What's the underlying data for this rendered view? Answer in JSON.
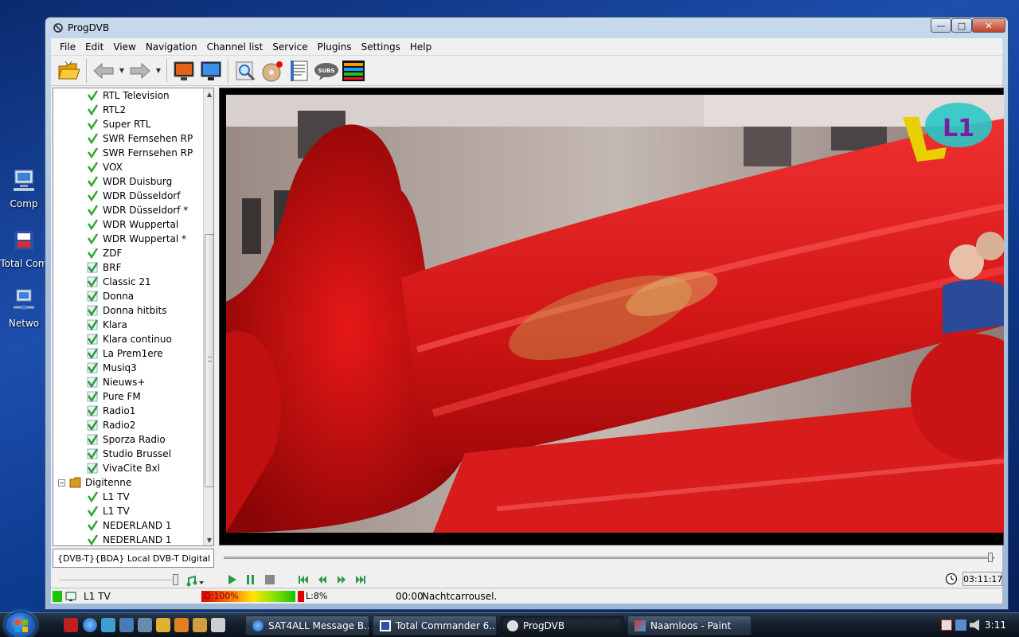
{
  "desktop": {
    "icons": [
      {
        "label": "Comp",
        "icon": "computer-icon"
      },
      {
        "label": "Total Com",
        "icon": "total-commander-icon"
      },
      {
        "label": "Netwo",
        "icon": "network-icon"
      }
    ]
  },
  "window": {
    "title": "ProgDVB",
    "buttons": {
      "minimize": "—",
      "maximize": "□",
      "close": "✕"
    }
  },
  "menu": [
    "File",
    "Edit",
    "View",
    "Navigation",
    "Channel list",
    "Service",
    "Plugins",
    "Settings",
    "Help"
  ],
  "toolbar": {
    "icons": [
      "open-folder-icon",
      "back-icon",
      "forward-icon",
      "tv-screen-icon",
      "monitor-icon",
      "scan-icon",
      "disc-record-icon",
      "epg-icon",
      "subs-icon",
      "equalizer-icon"
    ],
    "subs_label": "SUBS"
  },
  "channels": [
    {
      "name": "RTL Television",
      "type": "tv"
    },
    {
      "name": "RTL2",
      "type": "tv"
    },
    {
      "name": "Super RTL",
      "type": "tv"
    },
    {
      "name": "SWR Fernsehen RP",
      "type": "tv"
    },
    {
      "name": "SWR Fernsehen RP",
      "type": "tv"
    },
    {
      "name": "VOX",
      "type": "tv"
    },
    {
      "name": "WDR Duisburg",
      "type": "tv"
    },
    {
      "name": "WDR Düsseldorf",
      "type": "tv"
    },
    {
      "name": "WDR Düsseldorf *",
      "type": "tv"
    },
    {
      "name": "WDR Wuppertal",
      "type": "tv"
    },
    {
      "name": "WDR Wuppertal *",
      "type": "tv"
    },
    {
      "name": "ZDF",
      "type": "tv"
    },
    {
      "name": "BRF",
      "type": "radio"
    },
    {
      "name": "Classic 21",
      "type": "radio"
    },
    {
      "name": "Donna",
      "type": "radio"
    },
    {
      "name": "Donna hitbits",
      "type": "radio"
    },
    {
      "name": "Klara",
      "type": "radio"
    },
    {
      "name": "Klara continuo",
      "type": "radio"
    },
    {
      "name": "La Prem1ere",
      "type": "radio"
    },
    {
      "name": "Musiq3",
      "type": "radio"
    },
    {
      "name": "Nieuws+",
      "type": "radio"
    },
    {
      "name": "Pure FM",
      "type": "radio"
    },
    {
      "name": "Radio1",
      "type": "radio"
    },
    {
      "name": "Radio2",
      "type": "radio"
    },
    {
      "name": "Sporza Radio",
      "type": "radio"
    },
    {
      "name": "Studio Brussel",
      "type": "radio"
    },
    {
      "name": "VivaCite Bxl",
      "type": "radio"
    }
  ],
  "group": {
    "name": "Digitenne",
    "expander": "−"
  },
  "group_channels": [
    {
      "name": "L1 TV",
      "type": "tv"
    },
    {
      "name": "L1 TV",
      "type": "tv"
    },
    {
      "name": "NEDERLAND 1",
      "type": "tv"
    },
    {
      "name": "NEDERLAND 1",
      "type": "tv"
    }
  ],
  "source": "{DVB-T}{BDA} Local DVB-T Digital Antenna",
  "volume_level": 0.97,
  "playback": {
    "progress": 0.99,
    "time": "03:11:17",
    "buttons": [
      "play-icon",
      "pause-icon",
      "stop-icon",
      "skip-back-icon",
      "rewind-icon",
      "fast-forward-icon",
      "skip-forward-icon"
    ]
  },
  "video": {
    "logo_text": "L1"
  },
  "status": {
    "channel": "L1 TV",
    "quality": "Q:100%",
    "level": "L:8%",
    "epg_time": "00:00",
    "epg_title": "Nachtcarrousel."
  },
  "taskbar": {
    "tasks": [
      {
        "label": "SAT4ALL Message B...",
        "icon": "ie-icon",
        "active": false
      },
      {
        "label": "Total Commander 6...",
        "icon": "total-commander-icon",
        "active": false
      },
      {
        "label": "ProgDVB",
        "icon": "progdvb-icon",
        "active": true
      },
      {
        "label": "Naamloos - Paint",
        "icon": "paint-icon",
        "active": false
      }
    ],
    "clock": "3:11"
  },
  "colors": {
    "tv_check": "#2ea82e",
    "radio_check": "#2a9a48",
    "video_red": "#d81b1b",
    "status_green": "#19c400"
  }
}
